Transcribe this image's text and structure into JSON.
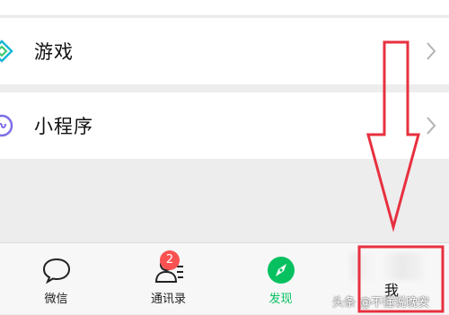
{
  "menu": {
    "games_label": "游戏",
    "mini_programs_label": "小程序"
  },
  "tabbar": {
    "items": [
      {
        "label": "微信",
        "icon": "chat-bubble-icon"
      },
      {
        "label": "通讯录",
        "icon": "contacts-icon",
        "badge": "2"
      },
      {
        "label": "发现",
        "icon": "compass-icon",
        "active": true
      },
      {
        "label": "我",
        "icon": "person-icon"
      }
    ]
  },
  "watermark": "头条 @不懂说晚安",
  "colors": {
    "accent": "#07c160",
    "badge": "#fa5151",
    "annotation": "#e8303f"
  }
}
